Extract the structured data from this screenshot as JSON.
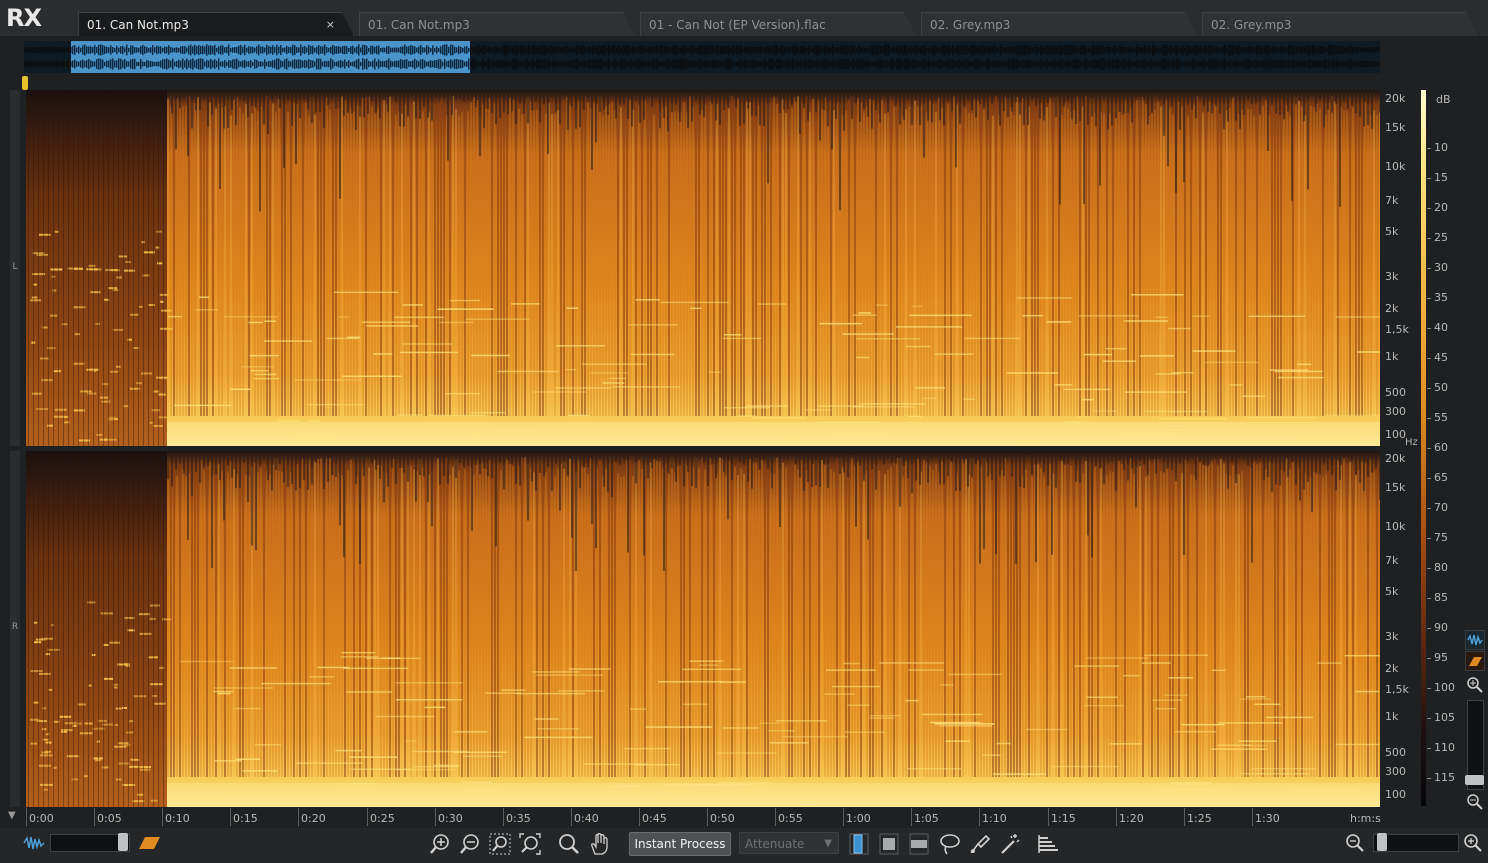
{
  "app": {
    "logo": "RX"
  },
  "tabs": [
    {
      "label": "01. Can Not.mp3",
      "active": true,
      "close": "×"
    },
    {
      "label": "01. Can Not.mp3"
    },
    {
      "label": "01 - Can Not (EP Version).flac"
    },
    {
      "label": "02. Grey.mp3"
    },
    {
      "label": "02. Grey.mp3"
    }
  ],
  "channels": {
    "left": "L",
    "right": "R"
  },
  "freq_axis": {
    "unit": "Hz",
    "labels": [
      "20k",
      "15k",
      "10k",
      "7k",
      "5k",
      "3k",
      "2k",
      "1,5k",
      "1k",
      "500",
      "300",
      "100"
    ]
  },
  "db_scale": {
    "unit": "dB",
    "labels": [
      "10",
      "15",
      "20",
      "25",
      "30",
      "35",
      "40",
      "45",
      "50",
      "55",
      "60",
      "65",
      "70",
      "75",
      "80",
      "85",
      "90",
      "95",
      "100",
      "105",
      "110",
      "115"
    ]
  },
  "time_axis": {
    "format": "h:m:s",
    "labels": [
      "0:00",
      "0:05",
      "0:10",
      "0:15",
      "0:20",
      "0:25",
      "0:30",
      "0:35",
      "0:40",
      "0:45",
      "0:50",
      "0:55",
      "1:00",
      "1:05",
      "1:10",
      "1:15",
      "1:20",
      "1:25",
      "1:30"
    ]
  },
  "toolbar": {
    "instant_process": "Instant Process",
    "attenuate": "Attenuate",
    "icons": [
      "waveform-view-icon",
      "spectrogram-view-icon",
      "zoom-in-icon",
      "zoom-out-icon",
      "zoom-selection-icon",
      "zoom-fit-icon",
      "magnify-icon",
      "hand-icon",
      "time-selection-icon",
      "time-frequency-selection-icon",
      "frequency-selection-icon",
      "lasso-icon",
      "brush-icon",
      "magic-wand-icon",
      "level-meter-icon",
      "zoom-out-horizontal-icon",
      "zoom-in-horizontal-icon"
    ]
  },
  "colors": {
    "accent_selection": "#4a96cc",
    "playhead": "#e6c22a",
    "spectrogram_hot": "#ffe27a",
    "spectrogram_mid": "#e08a22",
    "spectrogram_low": "#5a2610"
  }
}
